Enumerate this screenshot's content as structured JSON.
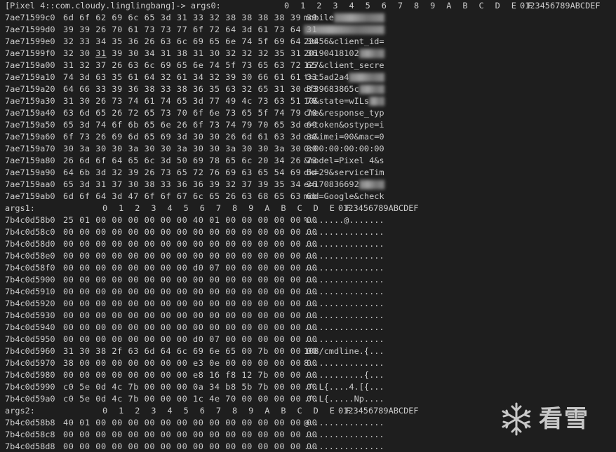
{
  "header": {
    "prefix": "[Pixel 4::com.cloudy.linglingbang]-> args0:",
    "columns": "0  1  2  3  4  5  6  7  8  9  A  B  C  D  E  F",
    "ascii_header": "0123456789ABCDEF"
  },
  "args0_rows": [
    {
      "addr": "7ae71599c0",
      "hex": "6d 6f 62 69 6c 65 3d 31 33 32 38 38 38 38 39 39",
      "ascii": "mobile",
      "redact": true
    },
    {
      "addr": "7ae71599d0",
      "hex": "39 39 26 70 61 73 73 77 6f 72 64 3d 61 73 64 31",
      "ascii": "",
      "redact": true
    },
    {
      "addr": "7ae71599e0",
      "hex": "32 33 34 35 36 26 63 6c 69 65 6e 74 5f 69 64 3d",
      "ascii": "23456&client_id="
    },
    {
      "addr": "7ae71599f0",
      "hex": "32 30 31 39 30 34 31 38 31 30 32 32 32 35 31 36",
      "ascii": "20190418102",
      "redact": true,
      "underline_third": true
    },
    {
      "addr": "7ae7159a00",
      "hex": "31 32 37 26 63 6c 69 65 6e 74 5f 73 65 63 72 65",
      "ascii": "127&client_secre"
    },
    {
      "addr": "7ae7159a10",
      "hex": "74 3d 63 35 61 64 32 61 34 32 39 30 66 61 61 33",
      "ascii": "t=c5ad2a4",
      "redact": true
    },
    {
      "addr": "7ae7159a20",
      "hex": "64 66 33 39 36 38 33 38 36 35 63 32 65 31 30 33",
      "ascii": "df39683865c",
      "redact": true
    },
    {
      "addr": "7ae7159a30",
      "hex": "31 30 26 73 74 61 74 65 3d 77 49 4c 73 63 51 78",
      "ascii": "10&state=wILs",
      "redact": true
    },
    {
      "addr": "7ae7159a40",
      "hex": "63 6d 65 26 72 65 73 70 6f 6e 73 65 5f 74 79 70",
      "ascii": "cme&response_typ"
    },
    {
      "addr": "7ae7159a50",
      "hex": "65 3d 74 6f 6b 65 6e 26 6f 73 74 79 70 65 3d 69",
      "ascii": "e=token&ostype=i"
    },
    {
      "addr": "7ae7159a60",
      "hex": "6f 73 26 69 6d 65 69 3d 30 30 26 6d 61 63 3d 30",
      "ascii": "os&imei=00&mac=0"
    },
    {
      "addr": "7ae7159a70",
      "hex": "30 3a 30 30 3a 30 30 3a 30 30 3a 30 30 3a 30 30",
      "ascii": "0:00:00:00:00:00"
    },
    {
      "addr": "7ae7159a80",
      "hex": "26 6d 6f 64 65 6c 3d 50 69 78 65 6c 20 34 26 73",
      "ascii": "&model=Pixel 4&s"
    },
    {
      "addr": "7ae7159a90",
      "hex": "64 6b 3d 32 39 26 73 65 72 76 69 63 65 54 69 6d",
      "ascii": "dk=29&serviceTim"
    },
    {
      "addr": "7ae7159aa0",
      "hex": "65 3d 31 37 30 38 33 36 36 39 32 37 39 35 34 26",
      "ascii": "e=170836692",
      "redact": true
    },
    {
      "addr": "7ae7159ab0",
      "hex": "6d 6f 64 3d 47 6f 6f 67 6c 65 26 63 68 65 63 6b",
      "ascii": "mod=Google&check"
    }
  ],
  "args1": {
    "label": "args1:",
    "columns": "0  1  2  3  4  5  6  7  8  9  A  B  C  D  E  F",
    "ascii_header": "0123456789ABCDEF",
    "rows": [
      {
        "addr": "7b4c0d58b0",
        "hex": "25 01 00 00 00 00 00 00 40 01 00 00 00 00 00 00",
        "ascii": "%.......@......."
      },
      {
        "addr": "7b4c0d58c0",
        "hex": "00 00 00 00 00 00 00 00 00 00 00 00 00 00 00 00",
        "ascii": "................"
      },
      {
        "addr": "7b4c0d58d0",
        "hex": "00 00 00 00 00 00 00 00 00 00 00 00 00 00 00 00",
        "ascii": "................"
      },
      {
        "addr": "7b4c0d58e0",
        "hex": "00 00 00 00 00 00 00 00 00 00 00 00 00 00 00 00",
        "ascii": "................"
      },
      {
        "addr": "7b4c0d58f0",
        "hex": "00 00 00 00 00 00 00 00 d0 07 00 00 00 00 00 00",
        "ascii": "................"
      },
      {
        "addr": "7b4c0d5900",
        "hex": "00 00 00 00 00 00 00 00 00 00 00 00 00 00 00 00",
        "ascii": "................"
      },
      {
        "addr": "7b4c0d5910",
        "hex": "00 00 00 00 00 00 00 00 00 00 00 00 00 00 00 00",
        "ascii": "................"
      },
      {
        "addr": "7b4c0d5920",
        "hex": "00 00 00 00 00 00 00 00 00 00 00 00 00 00 00 00",
        "ascii": "................"
      },
      {
        "addr": "7b4c0d5930",
        "hex": "00 00 00 00 00 00 00 00 00 00 00 00 00 00 00 00",
        "ascii": "................"
      },
      {
        "addr": "7b4c0d5940",
        "hex": "00 00 00 00 00 00 00 00 00 00 00 00 00 00 00 00",
        "ascii": "................"
      },
      {
        "addr": "7b4c0d5950",
        "hex": "00 00 00 00 00 00 00 00 d0 07 00 00 00 00 00 00",
        "ascii": "................"
      },
      {
        "addr": "7b4c0d5960",
        "hex": "31 30 38 2f 63 6d 64 6c 69 6e 65 00 7b 00 00 00",
        "ascii": "108/cmdline.{..."
      },
      {
        "addr": "7b4c0d5970",
        "hex": "38 00 00 00 00 00 00 00 e3 0e 00 00 00 00 00 00",
        "ascii": "8..............."
      },
      {
        "addr": "7b4c0d5980",
        "hex": "00 00 00 00 00 00 00 00 e8 16 f8 12 7b 00 00 00",
        "ascii": "............{..."
      },
      {
        "addr": "7b4c0d5990",
        "hex": "c0 5e 0d 4c 7b 00 00 00 0a 34 b8 5b 7b 00 00 00",
        "ascii": ".^.L{....4.[{..."
      },
      {
        "addr": "7b4c0d59a0",
        "hex": "c0 5e 0d 4c 7b 00 00 00 1c 4e 70 00 00 00 00 00",
        "ascii": ".^.L{.....Np...."
      }
    ]
  },
  "args2": {
    "label": "args2:",
    "columns": "0  1  2  3  4  5  6  7  8  9  A  B  C  D  E  F",
    "ascii_header": "0123456789ABCDEF",
    "rows": [
      {
        "addr": "7b4c0d58b8",
        "hex": "40 01 00 00 00 00 00 00 00 00 00 00 00 00 00 00",
        "ascii": "@..............."
      },
      {
        "addr": "7b4c0d58c8",
        "hex": "00 00 00 00 00 00 00 00 00 00 00 00 00 00 00 00",
        "ascii": "................"
      },
      {
        "addr": "7b4c0d58d8",
        "hex": "00 00 00 00 00 00 00 00 00 00 00 00 00 00 00 00",
        "ascii": "................"
      }
    ]
  },
  "watermark": {
    "text": "看雪",
    "icon": "snowflake-icon"
  }
}
